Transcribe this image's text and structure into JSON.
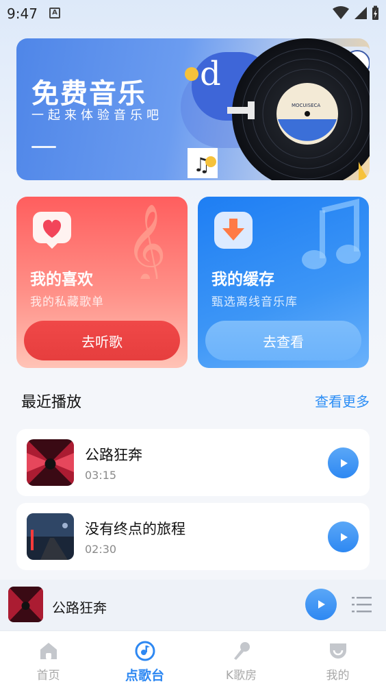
{
  "status_bar": {
    "time": "9:47",
    "notification_letter": "A"
  },
  "banner": {
    "title": "免费音乐",
    "subtitle": "一起来体验音乐吧"
  },
  "cards": [
    {
      "title": "我的喜欢",
      "subtitle": "我的私藏歌单",
      "button": "去听歌",
      "icon": "heart-icon"
    },
    {
      "title": "我的缓存",
      "subtitle": "甄选离线音乐库",
      "button": "去查看",
      "icon": "download-icon"
    }
  ],
  "recent": {
    "title": "最近播放",
    "see_more": "查看更多",
    "items": [
      {
        "name": "公路狂奔",
        "duration": "03:15"
      },
      {
        "name": "没有终点的旅程",
        "duration": "02:30"
      }
    ]
  },
  "mini_player": {
    "title": "公路狂奔"
  },
  "tabs": [
    {
      "label": "首页",
      "icon": "home-icon",
      "active": false
    },
    {
      "label": "点歌台",
      "icon": "music-note-icon",
      "active": true
    },
    {
      "label": "K歌房",
      "icon": "microphone-icon",
      "active": false
    },
    {
      "label": "我的",
      "icon": "profile-icon",
      "active": false
    }
  ],
  "colors": {
    "accent": "#2e88f2",
    "card_red": "#ff5e5e",
    "card_blue": "#1e7ef3"
  }
}
